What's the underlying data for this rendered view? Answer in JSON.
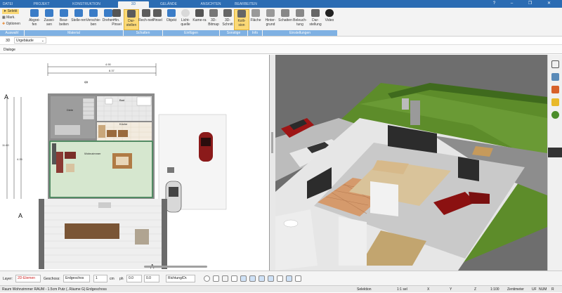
{
  "tabs": [
    "DATEI",
    "PROJEKT",
    "KONSTRUKTION",
    "3D",
    "GELÄNDE",
    "ANSICHTEN",
    "BEARBEITEN"
  ],
  "window_controls": "? – ❐ ✕",
  "ribbon": {
    "small_buttons": {
      "select": "Selekt",
      "mark": "Mark.",
      "options": "Optionen"
    },
    "buttons": {
      "abgreifen": "Abgrei-fen",
      "zuweisen": "Zuwei-sen",
      "bearbeiten": "Bear-beiten",
      "stellen": "Stelle-ren",
      "verschieben": "Verschie-ben",
      "drehen": "Drehen",
      "hinpinsel": "Hin. Pinsel",
      "darstellen": "Dar-stellen",
      "rechnen": "Rech-nen",
      "pinsel": "Pinsel",
      "objekt": "Objekt",
      "lichtquelle": "Licht-quelle",
      "kamera": "Kame-ra",
      "bitmap": "3D-Bitmap",
      "schnitt": "3D-Schnitt",
      "kollision": "Kolli-sion",
      "flaeche": "Fläche",
      "hintergrund": "Hinter-grund",
      "schatten": "Schatten",
      "beleuchtung": "Beleuch-tung",
      "darstellung": "Dar-stellung",
      "video": "Video"
    },
    "groups": {
      "auswahl": "Auswahl",
      "material": "Material",
      "schatten": "Schatten",
      "einfuegen": "Einfügen",
      "sonstige": "Sonstige",
      "info": "Info",
      "einstellungen": "Einstellungen"
    }
  },
  "subbar": {
    "mode": "3D",
    "view": "Urgebäude"
  },
  "dialog_label": "Dialoge",
  "plan": {
    "rooms": {
      "diele": "Diele",
      "bad": "Bad",
      "kueche": "Küche",
      "wohnzimmer": "Wohnzimmer"
    },
    "dim_labels": {
      "top1": "4.90",
      "top2": "8.37",
      "left": "11.60",
      "left2": "4.26"
    }
  },
  "bottombar": {
    "layer_label": "Layer:",
    "layer_value": "2D-Elemen",
    "geschoss_label": "Geschoss:",
    "geschoss_value": "Erdgeschos",
    "width_value": "1",
    "unit_cm": "cm",
    "ph_label": "ph",
    "ph_value": "0.0",
    "angle_value": "0.0",
    "direction": "Richtung/Dr."
  },
  "status": {
    "left": "Raum Wohnzimmer RAUM - 1.5cm Putz (..Räume G) Erdgeschoss",
    "selection": "Selektion",
    "scale": "1:1 sel",
    "x": "X",
    "y": "Y",
    "z": "Z",
    "ratio": "1:100",
    "unit": "Zentimeter",
    "caps": "UF",
    "num": "NUM",
    "mode": "R"
  },
  "colors": {
    "accent": "#2b6cb3",
    "active_tool": "#fbd976",
    "green_room": "#d6e7cf",
    "lawn": "#5d8c2a"
  }
}
